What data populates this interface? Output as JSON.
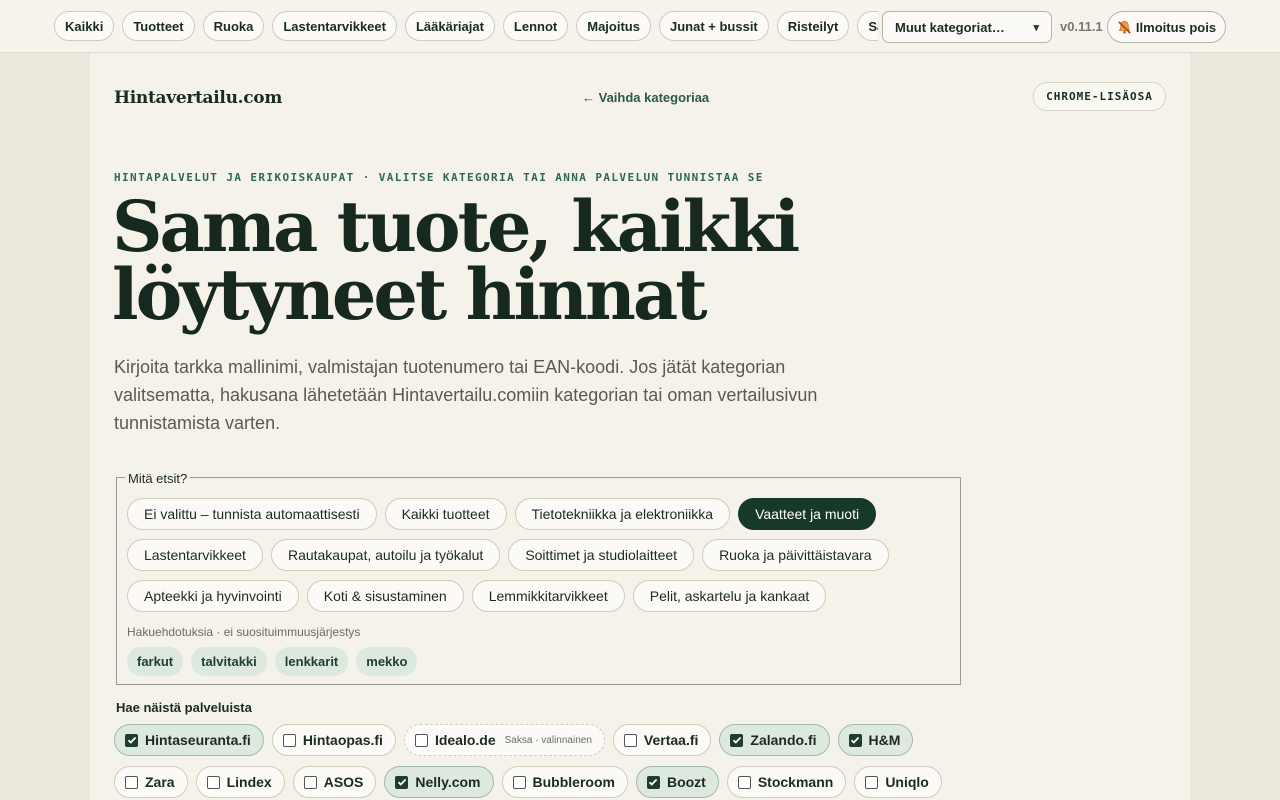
{
  "topbar": {
    "categories": [
      "Kaikki",
      "Tuotteet",
      "Ruoka",
      "Lastentarvikkeet",
      "Lääkäriajat",
      "Lennot",
      "Majoitus",
      "Junat + bussit",
      "Risteilyt",
      "Sähkö"
    ],
    "more_select": "Muut kategoriat…",
    "version": "v0.11.1",
    "notification_button": "Ilmoitus pois"
  },
  "header": {
    "brand": "Hintavertailu.com",
    "switch_category": "← Vaihda kategoriaa",
    "extension_badge": "CHROME-LISÄOSA"
  },
  "hero": {
    "eyebrow": "HINTAPALVELUT JA ERIKOISKAUPAT · VALITSE KATEGORIA TAI ANNA PALVELUN TUNNISTAA SE",
    "headline_line1": "Sama tuote, kaikki",
    "headline_line2": "löytyneet hinnat",
    "lede": "Kirjoita tarkka mallinimi, valmistajan tuotenumero tai EAN-koodi. Jos jätät kategorian valitsematta, hakusana lähetetään Hintavertailu.comiin kategorian tai oman vertailusivun tunnistamista varten."
  },
  "search_category": {
    "legend": "Mitä etsit?",
    "options": [
      {
        "label": "Ei valittu – tunnista automaattisesti",
        "active": false
      },
      {
        "label": "Kaikki tuotteet",
        "active": false
      },
      {
        "label": "Tietotekniikka ja elektroniikka",
        "active": false
      },
      {
        "label": "Vaatteet ja muoti",
        "active": true
      },
      {
        "label": "Lastentarvikkeet",
        "active": false
      },
      {
        "label": "Rautakaupat, autoilu ja työkalut",
        "active": false
      },
      {
        "label": "Soittimet ja studiolaitteet",
        "active": false
      },
      {
        "label": "Ruoka ja päivittäistavara",
        "active": false
      },
      {
        "label": "Apteekki ja hyvinvointi",
        "active": false
      },
      {
        "label": "Koti & sisustaminen",
        "active": false
      },
      {
        "label": "Lemmikkitarvikkeet",
        "active": false
      },
      {
        "label": "Pelit, askartelu ja kankaat",
        "active": false
      }
    ],
    "hint": "Hakuehdotuksia · ei suosituimmuusjärjestys",
    "suggestions": [
      "farkut",
      "talvitakki",
      "lenkkarit",
      "mekko"
    ]
  },
  "services": {
    "title": "Hae näistä palveluista",
    "items": [
      {
        "label": "Hintaseuranta.fi",
        "checked": true,
        "note": ""
      },
      {
        "label": "Hintaopas.fi",
        "checked": false,
        "note": ""
      },
      {
        "label": "Idealo.de",
        "checked": false,
        "note": "Saksa · valinnainen",
        "optional": true
      },
      {
        "label": "Vertaa.fi",
        "checked": false,
        "note": ""
      },
      {
        "label": "Zalando.fi",
        "checked": true,
        "note": ""
      },
      {
        "label": "H&M",
        "checked": true,
        "note": ""
      },
      {
        "label": "Zara",
        "checked": false,
        "note": ""
      },
      {
        "label": "Lindex",
        "checked": false,
        "note": ""
      },
      {
        "label": "ASOS",
        "checked": false,
        "note": ""
      },
      {
        "label": "Nelly.com",
        "checked": true,
        "note": ""
      },
      {
        "label": "Bubbleroom",
        "checked": false,
        "note": ""
      },
      {
        "label": "Boozt",
        "checked": true,
        "note": ""
      },
      {
        "label": "Stockmann",
        "checked": false,
        "note": ""
      },
      {
        "label": "Uniqlo",
        "checked": false,
        "note": ""
      }
    ]
  },
  "colors": {
    "accent_dark": "#17392a",
    "accent_link": "#2a5b3d",
    "checked_bg": "#dde8df"
  }
}
